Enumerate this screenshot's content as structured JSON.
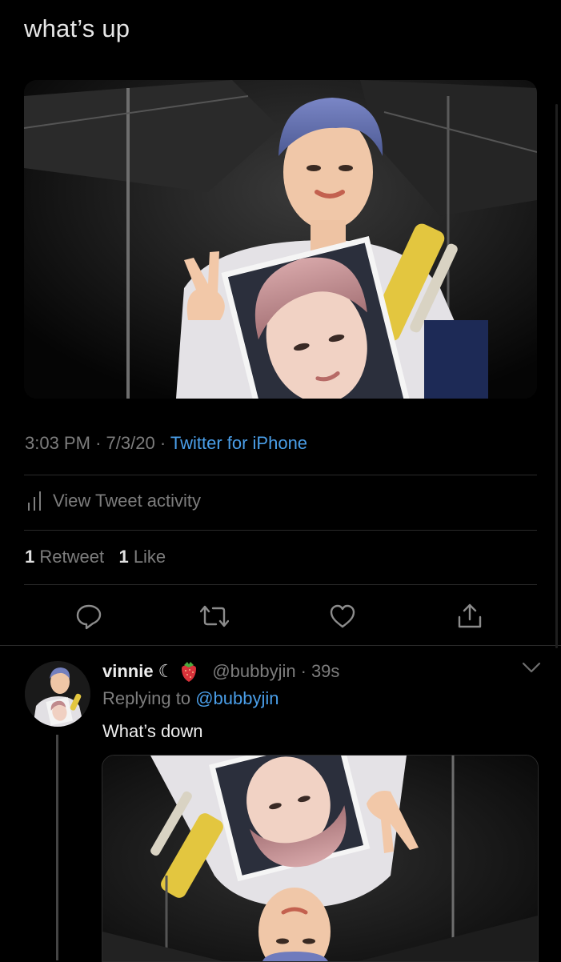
{
  "tweet": {
    "text": "what’s up",
    "time": "3:03 PM",
    "date": "7/3/20",
    "separator": "·",
    "source": "Twitter for iPhone",
    "activity_label": "View Tweet activity",
    "retweet_count": "1",
    "retweet_label": "Retweet",
    "like_count": "1",
    "like_label": "Like"
  },
  "actions": [
    "reply-icon",
    "retweet-icon",
    "like-icon",
    "share-icon"
  ],
  "reply": {
    "name": "vinnie",
    "emoji_moon": "☾",
    "handle": "@bubbyjin",
    "separator": "·",
    "age": "39s",
    "replying_prefix": "Replying to",
    "replying_handle": "@bubbyjin",
    "text": "What’s down"
  },
  "colors": {
    "background": "#000000",
    "link": "#4a9ee8",
    "muted": "#7d7d7d",
    "text": "#e7e7e7",
    "divider": "#2a2a2a"
  }
}
